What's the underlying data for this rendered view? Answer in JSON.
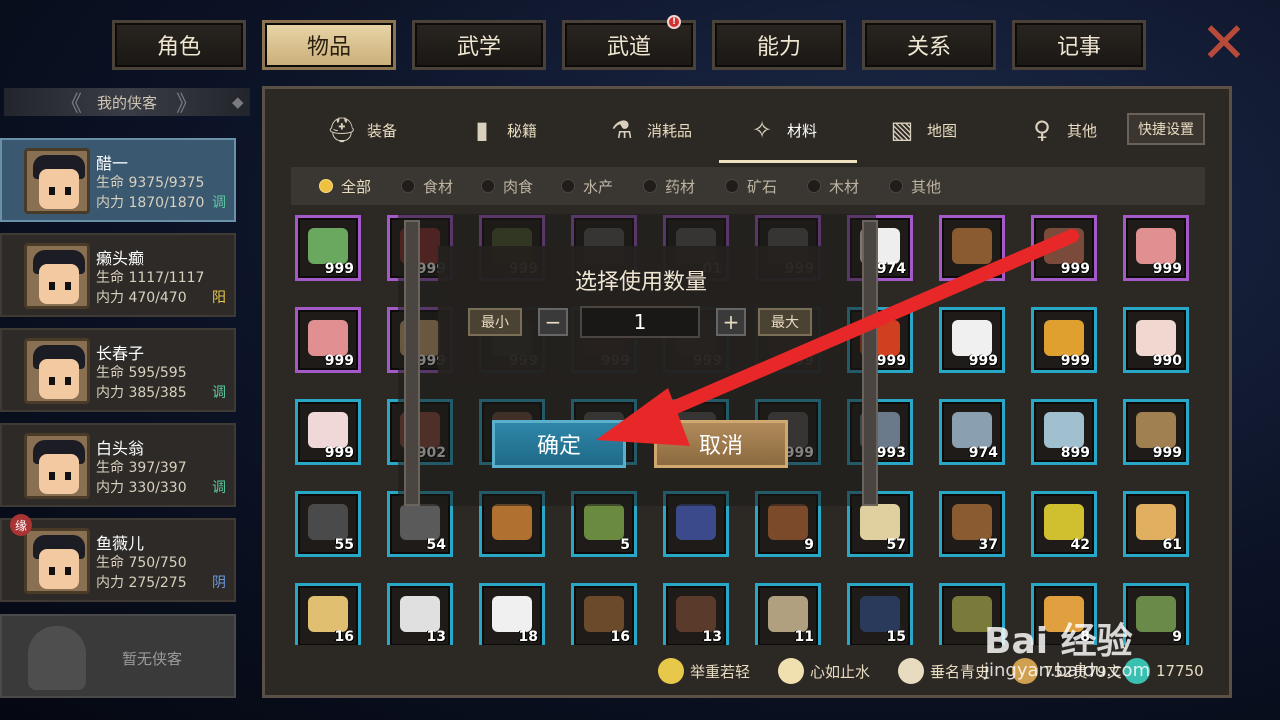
{
  "top_tabs": [
    {
      "label": "角色",
      "active": false
    },
    {
      "label": "物品",
      "active": true
    },
    {
      "label": "武学",
      "active": false
    },
    {
      "label": "武道",
      "active": false,
      "badge": "!"
    },
    {
      "label": "能力",
      "active": false
    },
    {
      "label": "关系",
      "active": false
    },
    {
      "label": "记事",
      "active": false
    }
  ],
  "close_icon": "✕",
  "sidebar": {
    "title": "我的侠客",
    "heroes": [
      {
        "name": "醋一",
        "hp": "生命 9375/9375",
        "mp": "内力 1870/1870",
        "tag": "调",
        "tag_color": "#5ac8a0",
        "active": true
      },
      {
        "name": "癞头癫",
        "hp": "生命 1117/1117",
        "mp": "内力 470/470",
        "tag": "阳",
        "tag_color": "#e8c84a",
        "active": false
      },
      {
        "name": "长春子",
        "hp": "生命 595/595",
        "mp": "内力 385/385",
        "tag": "调",
        "tag_color": "#5ac8a0",
        "active": false
      },
      {
        "name": "白头翁",
        "hp": "生命 397/397",
        "mp": "内力 330/330",
        "tag": "调",
        "tag_color": "#5ac8a0",
        "active": false
      },
      {
        "name": "鱼薇儿",
        "hp": "生命 750/750",
        "mp": "内力 275/275",
        "tag": "阴",
        "tag_color": "#6a9ae0",
        "active": false,
        "mark": "缘"
      }
    ],
    "empty_label": "暂无侠客"
  },
  "categories": [
    {
      "label": "装备",
      "icon": "helmet-icon",
      "glyph": "⛑"
    },
    {
      "label": "秘籍",
      "icon": "book-icon",
      "glyph": "▮"
    },
    {
      "label": "消耗品",
      "icon": "potion-icon",
      "glyph": "⚗"
    },
    {
      "label": "材料",
      "icon": "feather-icon",
      "glyph": "✧",
      "active": true
    },
    {
      "label": "地图",
      "icon": "map-icon",
      "glyph": "▧"
    },
    {
      "label": "其他",
      "icon": "lantern-icon",
      "glyph": "♀"
    }
  ],
  "quick_settings": "快捷设置",
  "filters": [
    {
      "label": "全部",
      "on": true
    },
    {
      "label": "食材"
    },
    {
      "label": "肉食"
    },
    {
      "label": "水产"
    },
    {
      "label": "药材"
    },
    {
      "label": "矿石"
    },
    {
      "label": "木材"
    },
    {
      "label": "其他"
    }
  ],
  "items": [
    {
      "row": 0,
      "col": 0,
      "q": "999",
      "frame": "purple",
      "color": "#6aa860"
    },
    {
      "row": 0,
      "col": 1,
      "q": "999",
      "frame": "purple",
      "color": "#8a3030"
    },
    {
      "row": 0,
      "col": 2,
      "q": "999",
      "frame": "purple",
      "color": "#4a5a30"
    },
    {
      "row": 0,
      "col": 3,
      "q": "",
      "frame": "purple",
      "color": "#555"
    },
    {
      "row": 0,
      "col": 4,
      "q": "01",
      "frame": "purple",
      "color": "#555"
    },
    {
      "row": 0,
      "col": 5,
      "q": "999",
      "frame": "purple",
      "color": "#555"
    },
    {
      "row": 0,
      "col": 6,
      "q": "974",
      "frame": "purple",
      "color": "#eee"
    },
    {
      "row": 0,
      "col": 7,
      "q": "",
      "frame": "purple",
      "color": "#8a5a30"
    },
    {
      "row": 0,
      "col": 8,
      "q": "999",
      "frame": "purple",
      "color": "#7a4a3a"
    },
    {
      "row": 0,
      "col": 9,
      "q": "999",
      "frame": "purple",
      "color": "#e09090"
    },
    {
      "row": 1,
      "col": 0,
      "q": "999",
      "frame": "purple",
      "color": "#e09090"
    },
    {
      "row": 1,
      "col": 1,
      "q": "999",
      "frame": "purple",
      "color": "#c8a070"
    },
    {
      "row": 1,
      "col": 2,
      "q": "999",
      "frame": "blue",
      "color": "#6a8a50"
    },
    {
      "row": 1,
      "col": 3,
      "q": "999",
      "frame": "blue",
      "color": "#6a4a3a"
    },
    {
      "row": 1,
      "col": 4,
      "q": "999",
      "frame": "blue",
      "color": "#6a5a4a"
    },
    {
      "row": 1,
      "col": 5,
      "q": "999",
      "frame": "blue",
      "color": "#7a3a3a"
    },
    {
      "row": 1,
      "col": 6,
      "q": "999",
      "frame": "blue",
      "color": "#d04020"
    },
    {
      "row": 1,
      "col": 7,
      "q": "999",
      "frame": "blue",
      "color": "#f0f0f0"
    },
    {
      "row": 1,
      "col": 8,
      "q": "999",
      "frame": "blue",
      "color": "#e0a030"
    },
    {
      "row": 1,
      "col": 9,
      "q": "990",
      "frame": "blue",
      "color": "#f0d8d0"
    },
    {
      "row": 2,
      "col": 0,
      "q": "999",
      "frame": "blue",
      "color": "#f0d8d8"
    },
    {
      "row": 2,
      "col": 1,
      "q": "902",
      "frame": "blue",
      "color": "#8a4a3a"
    },
    {
      "row": 2,
      "col": 2,
      "q": "",
      "frame": "blue",
      "color": "#6a4a3a"
    },
    {
      "row": 2,
      "col": 3,
      "q": "",
      "frame": "blue",
      "color": "#555"
    },
    {
      "row": 2,
      "col": 4,
      "q": "",
      "frame": "blue",
      "color": "#555"
    },
    {
      "row": 2,
      "col": 5,
      "q": "999",
      "frame": "blue",
      "color": "#555"
    },
    {
      "row": 2,
      "col": 6,
      "q": "993",
      "frame": "blue",
      "color": "#6a7a8a"
    },
    {
      "row": 2,
      "col": 7,
      "q": "974",
      "frame": "blue",
      "color": "#8aa0b0"
    },
    {
      "row": 2,
      "col": 8,
      "q": "899",
      "frame": "blue",
      "color": "#a0c0d0"
    },
    {
      "row": 2,
      "col": 9,
      "q": "999",
      "frame": "blue",
      "color": "#a08050"
    },
    {
      "row": 3,
      "col": 0,
      "q": "55",
      "frame": "blue",
      "color": "#4a4a4a"
    },
    {
      "row": 3,
      "col": 1,
      "q": "54",
      "frame": "blue",
      "color": "#5a5a5a"
    },
    {
      "row": 3,
      "col": 2,
      "q": "",
      "frame": "blue",
      "color": "#b07030"
    },
    {
      "row": 3,
      "col": 3,
      "q": "5",
      "frame": "blue",
      "color": "#6a8a40"
    },
    {
      "row": 3,
      "col": 4,
      "q": "",
      "frame": "blue",
      "color": "#3a4a8a"
    },
    {
      "row": 3,
      "col": 5,
      "q": "9",
      "frame": "blue",
      "color": "#7a4a2a"
    },
    {
      "row": 3,
      "col": 6,
      "q": "57",
      "frame": "blue",
      "color": "#e0d0a0"
    },
    {
      "row": 3,
      "col": 7,
      "q": "37",
      "frame": "blue",
      "color": "#8a5a30"
    },
    {
      "row": 3,
      "col": 8,
      "q": "42",
      "frame": "blue",
      "color": "#d0c030"
    },
    {
      "row": 3,
      "col": 9,
      "q": "61",
      "frame": "blue",
      "color": "#e0b060"
    },
    {
      "row": 4,
      "col": 0,
      "q": "16",
      "frame": "blue",
      "color": "#e0c070"
    },
    {
      "row": 4,
      "col": 1,
      "q": "13",
      "frame": "blue",
      "color": "#e0e0e0"
    },
    {
      "row": 4,
      "col": 2,
      "q": "18",
      "frame": "blue",
      "color": "#f0f0f0"
    },
    {
      "row": 4,
      "col": 3,
      "q": "16",
      "frame": "blue",
      "color": "#6a4a2a"
    },
    {
      "row": 4,
      "col": 4,
      "q": "13",
      "frame": "blue",
      "color": "#5a3a2a"
    },
    {
      "row": 4,
      "col": 5,
      "q": "11",
      "frame": "blue",
      "color": "#b0a080"
    },
    {
      "row": 4,
      "col": 6,
      "q": "15",
      "frame": "blue",
      "color": "#2a3a5a"
    },
    {
      "row": 4,
      "col": 7,
      "q": "",
      "frame": "blue",
      "color": "#7a7a3a"
    },
    {
      "row": 4,
      "col": 8,
      "q": "8",
      "frame": "blue",
      "color": "#e0a040"
    },
    {
      "row": 4,
      "col": 9,
      "q": "9",
      "frame": "blue",
      "color": "#6a8a4a"
    }
  ],
  "dialog": {
    "title": "选择使用数量",
    "min_label": "最小",
    "minus": "−",
    "value": "1",
    "plus": "+",
    "max_label": "最大",
    "confirm": "确定",
    "cancel": "取消"
  },
  "footer": [
    {
      "label": "举重若轻",
      "icon": "muscle-icon",
      "color": "#e8c84a"
    },
    {
      "label": "心如止水",
      "icon": "calm-face-icon",
      "color": "#f0e0b0"
    },
    {
      "label": "垂名青史",
      "icon": "scroll-icon",
      "color": "#e8dcc0"
    },
    {
      "label": "752贯79文",
      "icon": "coin-icon",
      "color": "#d0a050"
    },
    {
      "label": "17750",
      "icon": "gem-icon",
      "color": "#3ac0b0"
    }
  ],
  "watermark": {
    "logo": "Bai 经验",
    "url": "jingyan.baidu.com"
  }
}
